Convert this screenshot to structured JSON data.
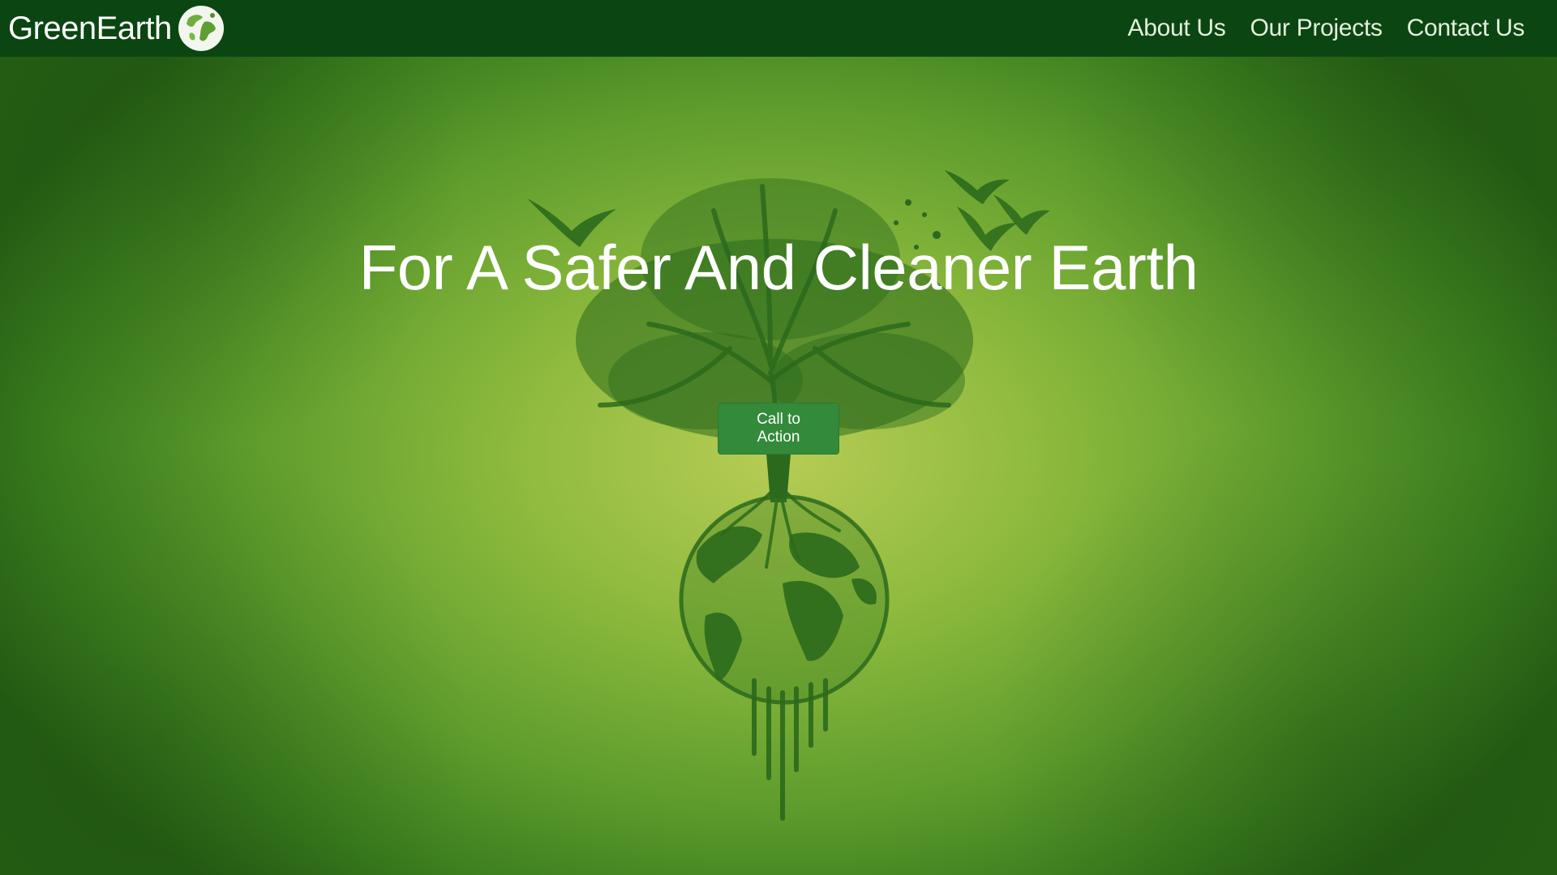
{
  "header": {
    "brand": "GreenEarth",
    "logo_icon": "earth-globe-icon",
    "nav": [
      {
        "label": "About Us"
      },
      {
        "label": "Our Projects"
      },
      {
        "label": "Contact Us"
      }
    ]
  },
  "hero": {
    "headline": "For A Safer And Cleaner Earth",
    "cta_label": "Call to Action",
    "illustration": "tree-rooted-in-earth-with-birds"
  },
  "colors": {
    "nav_background": "#0b4612",
    "hero_center": "#b7cc55",
    "hero_edge": "#255e14",
    "cta_background": "#338a3a",
    "illustration": "#2b6a1c"
  }
}
